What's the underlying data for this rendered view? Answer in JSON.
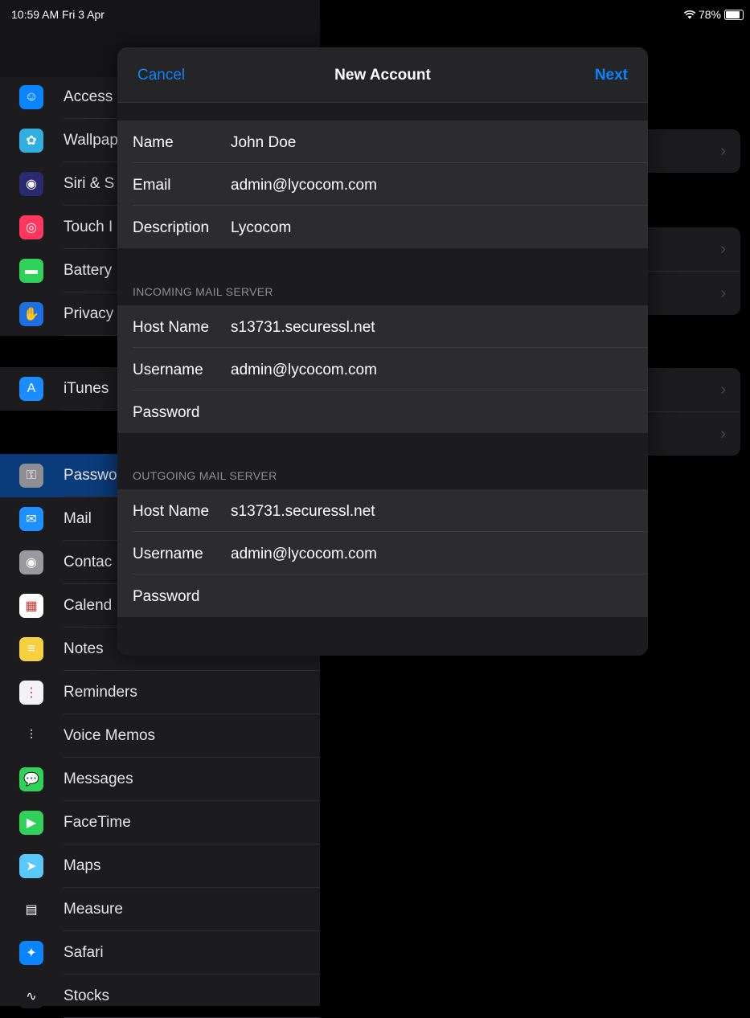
{
  "status_bar": {
    "time": "10:59 AM  Fri 3 Apr",
    "battery": "78%"
  },
  "sidebar": {
    "items": [
      {
        "label": "Access",
        "icon": "accessibility-icon",
        "color": "#0a84ff",
        "glyph": "☺"
      },
      {
        "label": "Wallpap",
        "icon": "wallpaper-icon",
        "color": "#30aee0",
        "glyph": "✿"
      },
      {
        "label": "Siri & S",
        "icon": "siri-icon",
        "color": "#2a2a6e",
        "glyph": "◉"
      },
      {
        "label": "Touch I",
        "icon": "touch-id-icon",
        "color": "#ff375f",
        "glyph": "◎"
      },
      {
        "label": "Battery",
        "icon": "battery-icon",
        "color": "#30d158",
        "glyph": "▬"
      },
      {
        "label": "Privacy",
        "icon": "privacy-hand-icon",
        "color": "#1e6fe0",
        "glyph": "✋"
      },
      {
        "label": "iTunes",
        "icon": "app-store-icon",
        "color": "#1a8cff",
        "glyph": "A"
      },
      {
        "label": "Passwo",
        "icon": "key-icon",
        "color": "#8e8e93",
        "glyph": "⚿"
      },
      {
        "label": "Mail",
        "icon": "mail-icon",
        "color": "#1e90ff",
        "glyph": "✉"
      },
      {
        "label": "Contac",
        "icon": "contacts-icon",
        "color": "#9a9a9e",
        "glyph": "◉"
      },
      {
        "label": "Calend",
        "icon": "calendar-icon",
        "color": "#ffffff",
        "glyph": "▦"
      },
      {
        "label": "Notes",
        "icon": "notes-icon",
        "color": "#f5d142",
        "glyph": "≡"
      },
      {
        "label": "Reminders",
        "icon": "reminders-icon",
        "color": "#f2f2f7",
        "glyph": "⋮"
      },
      {
        "label": "Voice Memos",
        "icon": "voice-memos-icon",
        "color": "#1c1c1e",
        "glyph": "⫶"
      },
      {
        "label": "Messages",
        "icon": "messages-icon",
        "color": "#30d158",
        "glyph": "💬"
      },
      {
        "label": "FaceTime",
        "icon": "facetime-icon",
        "color": "#30d158",
        "glyph": "▶"
      },
      {
        "label": "Maps",
        "icon": "maps-icon",
        "color": "#5ac8fa",
        "glyph": "➤"
      },
      {
        "label": "Measure",
        "icon": "measure-icon",
        "color": "#1c1c1e",
        "glyph": "▤"
      },
      {
        "label": "Safari",
        "icon": "safari-icon",
        "color": "#0a84ff",
        "glyph": "✦"
      },
      {
        "label": "Stocks",
        "icon": "stocks-icon",
        "color": "#1c1c1e",
        "glyph": "∿"
      }
    ]
  },
  "modal": {
    "cancel_label": "Cancel",
    "title": "New Account",
    "next_label": "Next",
    "account": {
      "name_label": "Name",
      "name_value": "John Doe",
      "email_label": "Email",
      "email_value": "admin@lycocom.com",
      "description_label": "Description",
      "description_value": "Lycocom"
    },
    "incoming": {
      "section_title": "INCOMING MAIL SERVER",
      "host_label": "Host Name",
      "host_value": "s13731.securessl.net",
      "username_label": "Username",
      "username_value": "admin@lycocom.com",
      "password_label": "Password",
      "password_value": ""
    },
    "outgoing": {
      "section_title": "OUTGOING MAIL SERVER",
      "host_label": "Host Name",
      "host_value": "s13731.securessl.net",
      "username_label": "Username",
      "username_value": "admin@lycocom.com",
      "password_label": "Password",
      "password_value": ""
    }
  },
  "colors": {
    "accent": "#0a84ff",
    "sheet_bg": "#1c1c1e",
    "row_bg": "#2c2c2e"
  }
}
